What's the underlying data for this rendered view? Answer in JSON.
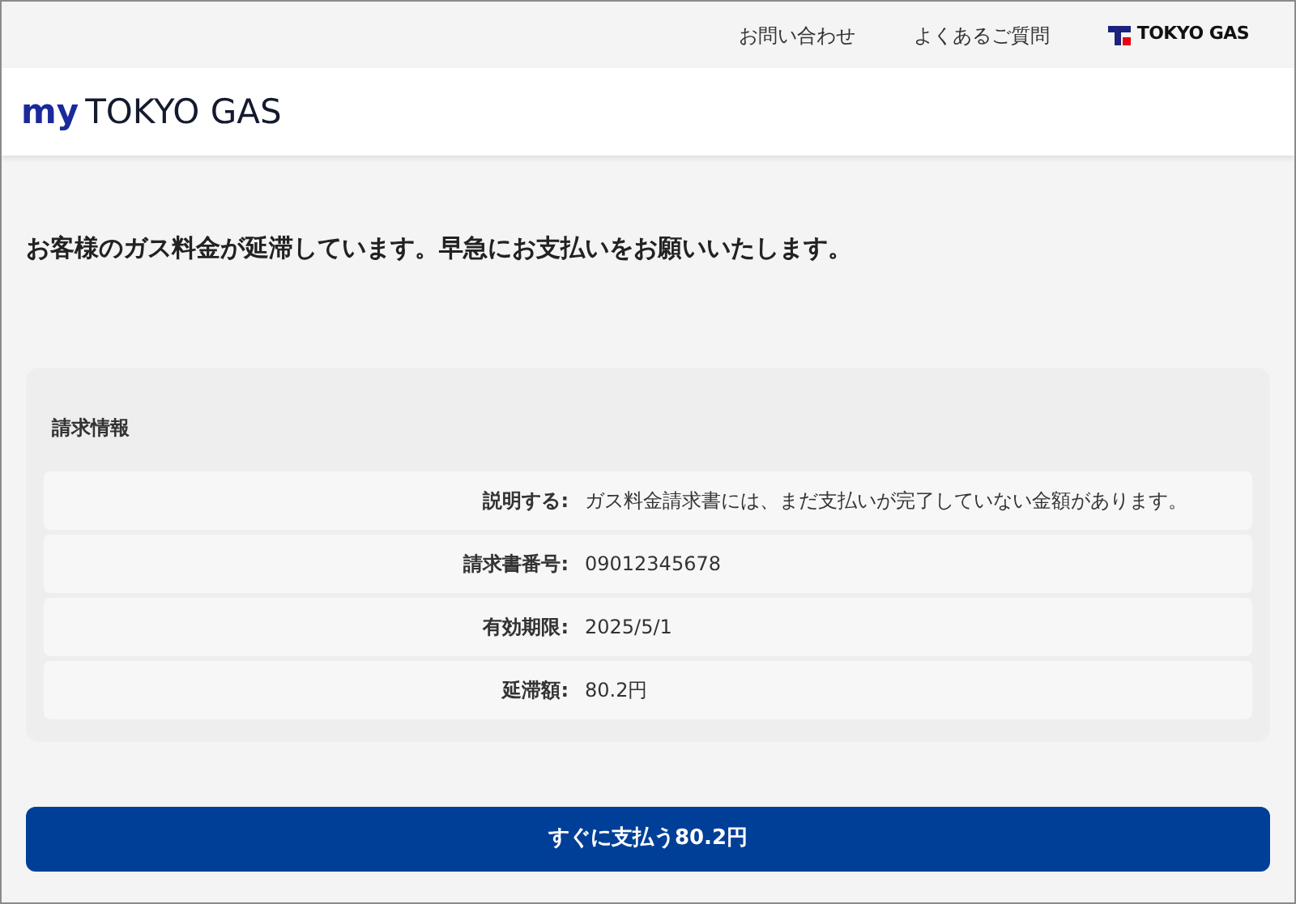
{
  "top_links": [
    "お問い合わせ",
    "よくあるご質問"
  ],
  "brand_small": "TOKYO GAS",
  "logo": {
    "prefix": "my",
    "name": "TOKYO GAS"
  },
  "notice": "お客様のガス料金が延滞しています。早急にお支払いをお願いいたします。",
  "billing": {
    "title": "請求情報",
    "rows": [
      {
        "label": "説明する:",
        "value": "ガス料金請求書には、まだ支払いが完了していない金額があります。"
      },
      {
        "label": "請求書番号:",
        "value": "09012345678"
      },
      {
        "label": "有効期限:",
        "value": "2025/5/1"
      },
      {
        "label": "延滞額:",
        "value": "80.2円"
      }
    ]
  },
  "pay_button": "すぐに支払う80.2円"
}
